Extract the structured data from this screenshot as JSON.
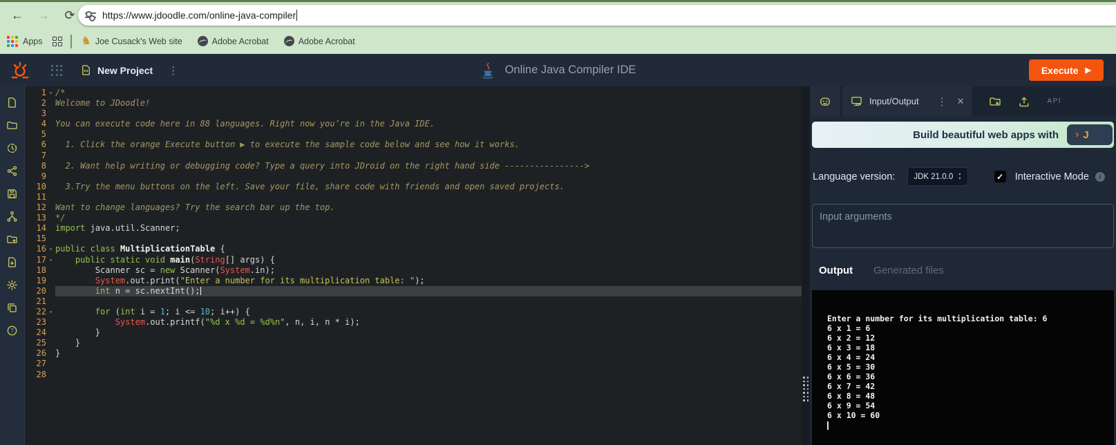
{
  "browser": {
    "url": "https://www.jdoodle.com/online-java-compiler",
    "back": "←",
    "forward": "→",
    "reload": "⟳",
    "bookmarks": {
      "apps_label": "Apps",
      "items": [
        "Joe Cusack's Web site",
        "Adobe Acrobat",
        "Adobe Acrobat"
      ]
    }
  },
  "header": {
    "project_name": "New Project",
    "title": "Online Java Compiler IDE",
    "execute_label": "Execute"
  },
  "icons": {
    "kebab": "⋮",
    "close": "✕",
    "play": "▶",
    "check": "✓",
    "fold": "▾",
    "caret_up": "▲",
    "caret_down": "▼",
    "info": "i",
    "knight": "♞",
    "chevron": "›",
    "logo_fragment": "J"
  },
  "sidebar_icons": [
    "new-file",
    "open-folder",
    "recent-history",
    "share",
    "save",
    "git-fork",
    "open-project-upload",
    "download-file",
    "settings",
    "duplicate",
    "help"
  ],
  "editor": {
    "lines": [
      {
        "n": 1,
        "fold": true,
        "segs": [
          [
            "/*",
            "cm"
          ]
        ]
      },
      {
        "n": 2,
        "segs": [
          [
            "Welcome to JDoodle!",
            "cm"
          ]
        ]
      },
      {
        "n": 3,
        "segs": []
      },
      {
        "n": 4,
        "segs": [
          [
            "You can execute code here in 88 languages. Right now you’re in the Java IDE.",
            "cm"
          ]
        ]
      },
      {
        "n": 5,
        "segs": []
      },
      {
        "n": 6,
        "segs": [
          [
            "  1. Click the orange Execute button ▶ to execute the sample code below and see how it works.",
            "cm"
          ]
        ]
      },
      {
        "n": 7,
        "segs": []
      },
      {
        "n": 8,
        "segs": [
          [
            "  2. Want help writing or debugging code? Type a query into JDroid on the right hand side ---------------->",
            "cm"
          ]
        ]
      },
      {
        "n": 9,
        "segs": []
      },
      {
        "n": 10,
        "segs": [
          [
            "  3.Try the menu buttons on the left. Save your file, share code with friends and open saved projects.",
            "cm"
          ]
        ]
      },
      {
        "n": 11,
        "segs": []
      },
      {
        "n": 12,
        "segs": [
          [
            "Want to change languages? Try the search bar up the top.",
            "cm"
          ]
        ]
      },
      {
        "n": 13,
        "segs": [
          [
            "*/",
            "cm"
          ]
        ]
      },
      {
        "n": 14,
        "segs": [
          [
            "import",
            "kw"
          ],
          [
            " java.util.Scanner;",
            "pl"
          ]
        ]
      },
      {
        "n": 15,
        "segs": []
      },
      {
        "n": 16,
        "fold": true,
        "segs": [
          [
            "public class",
            "kw"
          ],
          [
            " ",
            "pl"
          ],
          [
            "MultiplicationTable",
            "cl"
          ],
          [
            " {",
            "pl"
          ]
        ]
      },
      {
        "n": 17,
        "fold": true,
        "segs": [
          [
            "    ",
            "pl"
          ],
          [
            "public static void",
            "kw"
          ],
          [
            " ",
            "pl"
          ],
          [
            "main",
            "cl"
          ],
          [
            "(",
            "pl"
          ],
          [
            "String",
            "rd"
          ],
          [
            "[] args) {",
            "pl"
          ]
        ]
      },
      {
        "n": 18,
        "segs": [
          [
            "        Scanner sc = ",
            "pl"
          ],
          [
            "new",
            "kw"
          ],
          [
            " Scanner(",
            "pl"
          ],
          [
            "System",
            "rd"
          ],
          [
            ".in);",
            "pl"
          ]
        ]
      },
      {
        "n": 19,
        "segs": [
          [
            "        ",
            "pl"
          ],
          [
            "System",
            "rd"
          ],
          [
            ".out.print(",
            "pl"
          ],
          [
            "\"Enter a number for its multiplication table: \"",
            "st"
          ],
          [
            ");",
            "pl"
          ]
        ]
      },
      {
        "n": 20,
        "active": true,
        "cursor": true,
        "segs": [
          [
            "        ",
            "pl"
          ],
          [
            "int",
            "kw"
          ],
          [
            " n = sc.nextInt();",
            "pl"
          ]
        ]
      },
      {
        "n": 21,
        "segs": []
      },
      {
        "n": 22,
        "fold": true,
        "segs": [
          [
            "        ",
            "pl"
          ],
          [
            "for",
            "kw"
          ],
          [
            " (",
            "pl"
          ],
          [
            "int",
            "kw"
          ],
          [
            " i = ",
            "pl"
          ],
          [
            "1",
            "nu"
          ],
          [
            "; i <= ",
            "pl"
          ],
          [
            "10",
            "nu"
          ],
          [
            "; i++) {",
            "pl"
          ]
        ]
      },
      {
        "n": 23,
        "segs": [
          [
            "            ",
            "pl"
          ],
          [
            "System",
            "rd"
          ],
          [
            ".out.printf(",
            "pl"
          ],
          [
            "\"",
            "st"
          ],
          [
            "%d",
            "fm"
          ],
          [
            " x ",
            "st"
          ],
          [
            "%d",
            "fm"
          ],
          [
            " = ",
            "st"
          ],
          [
            "%d%n",
            "fm"
          ],
          [
            "\"",
            "st"
          ],
          [
            ", n, i, n * i);",
            "pl"
          ]
        ]
      },
      {
        "n": 24,
        "segs": [
          [
            "        }",
            "pl"
          ]
        ]
      },
      {
        "n": 25,
        "segs": [
          [
            "    }",
            "pl"
          ]
        ]
      },
      {
        "n": 26,
        "segs": [
          [
            "}",
            "pl"
          ]
        ]
      },
      {
        "n": 27,
        "segs": []
      },
      {
        "n": 28,
        "segs": []
      }
    ]
  },
  "panel": {
    "io_tab_label": "Input/Output",
    "api_label": "API",
    "banner_text": "Build beautiful web apps with",
    "language_label": "Language version:",
    "language_value": "JDK 21.0.0",
    "interactive_label": "Interactive Mode",
    "input_placeholder": "Input arguments",
    "tab_output": "Output",
    "tab_generated": "Generated files",
    "console_lines": [
      "Enter a number for its multiplication table: 6",
      "6 x 1 = 6",
      "6 x 2 = 12",
      "6 x 3 = 18",
      "6 x 4 = 24",
      "6 x 5 = 30",
      "6 x 6 = 36",
      "6 x 7 = 42",
      "6 x 8 = 48",
      "6 x 9 = 54",
      "6 x 10 = 60"
    ]
  },
  "colors": {
    "accent_orange": "#f4550e",
    "chrome_green": "#cfe6ca",
    "header_navy": "#202a38",
    "editor_bg": "#1e2124",
    "console_bg": "#050505",
    "keyword_green": "#94c14e",
    "string_yellow": "#c4c359",
    "error_red": "#e8584e",
    "number_cyan": "#53b9c9",
    "line_number_amber": "#daa152"
  }
}
